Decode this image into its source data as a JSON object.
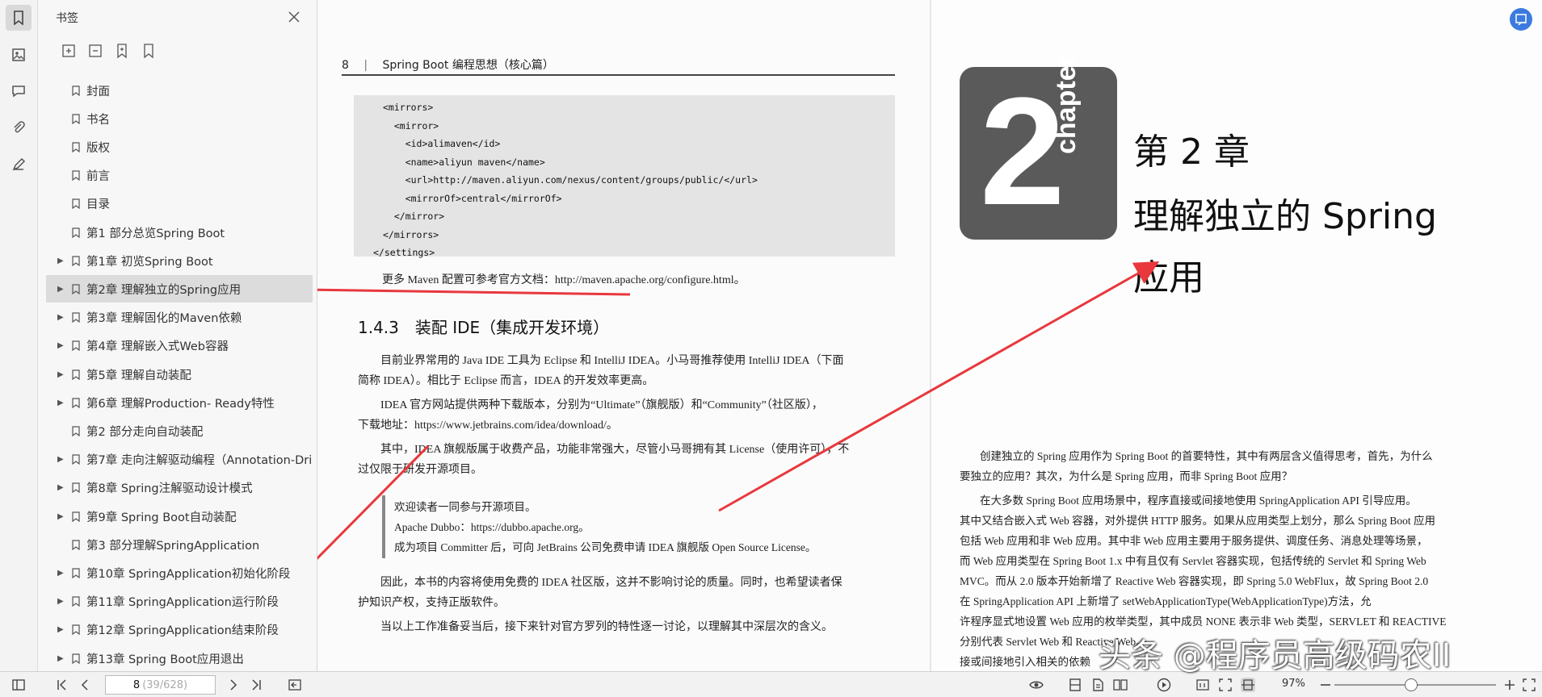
{
  "panel": {
    "title": "书签",
    "items": [
      {
        "label": "封面",
        "expandable": false
      },
      {
        "label": "书名",
        "expandable": false
      },
      {
        "label": "版权",
        "expandable": false
      },
      {
        "label": "前言",
        "expandable": false
      },
      {
        "label": "目录",
        "expandable": false
      },
      {
        "label": "第1 部分总览Spring Boot",
        "expandable": false
      },
      {
        "label": "第1章 初览Spring Boot",
        "expandable": true
      },
      {
        "label": "第2章 理解独立的Spring应用",
        "expandable": true
      },
      {
        "label": "第3章 理解固化的Maven依赖",
        "expandable": true
      },
      {
        "label": "第4章 理解嵌入式Web容器",
        "expandable": true
      },
      {
        "label": "第5章 理解自动装配",
        "expandable": true
      },
      {
        "label": "第6章 理解Production- Ready特性",
        "expandable": true
      },
      {
        "label": "第2 部分走向自动装配",
        "expandable": false
      },
      {
        "label": "第7章 走向注解驱动编程（Annotation-Dri",
        "expandable": true
      },
      {
        "label": "第8章 Spring注解驱动设计模式",
        "expandable": true
      },
      {
        "label": "第9章 Spring Boot自动装配",
        "expandable": true
      },
      {
        "label": "第3 部分理解SpringApplication",
        "expandable": false
      },
      {
        "label": "第10章 SpringApplication初始化阶段",
        "expandable": true
      },
      {
        "label": "第11章 SpringApplication运行阶段",
        "expandable": true
      },
      {
        "label": "第12章 SpringApplication结束阶段",
        "expandable": true
      },
      {
        "label": "第13章 Spring Boot应用退出",
        "expandable": true
      }
    ],
    "selected_index": 7
  },
  "left_page": {
    "header_num": "8",
    "header_title": "Spring Boot 编程思想（核心篇）",
    "code_lines": [
      "<mirrors>",
      "  <mirror>",
      "    <id>alimaven</id>",
      "    <name>aliyun maven</name>",
      "    <url>http://maven.aliyun.com/nexus/content/groups/public/</url>",
      "    <mirrorOf>central</mirrorOf>",
      "  </mirror>",
      "</mirrors>",
      "</settings>"
    ],
    "maven_note": "更多 Maven 配置可参考官方文档：http://maven.apache.org/configure.html。",
    "section": "1.4.3　装配 IDE（集成开发环境）",
    "para1_l1": "目前业界常用的 Java IDE 工具为 Eclipse 和 IntelliJ IDEA。小马哥推荐使用 IntelliJ IDEA（下面",
    "para1_l2": "简称 IDEA）。相比于 Eclipse 而言，IDEA 的开发效率更高。",
    "para2_l1": "IDEA 官方网站提供两种下载版本，分别为“Ultimate”（旗舰版）和“Community”（社区版），",
    "para2_l2": "下载地址：https://www.jetbrains.com/idea/download/。",
    "para3_l1": "其中，IDEA 旗舰版属于收费产品，功能非常强大，尽管小马哥拥有其 License（使用许可），不",
    "para3_l2": "过仅限于研发开源项目。",
    "quote_l1": "欢迎读者一同参与开源项目。",
    "quote_l2": "Apache Dubbo：https://dubbo.apache.org。",
    "quote_l3": "成为项目 Committer 后，可向 JetBrains 公司免费申请 IDEA 旗舰版 Open Source License。",
    "para4_l1": "因此，本书的内容将使用免费的 IDEA 社区版，这并不影响讨论的质量。同时，也希望读者保",
    "para4_l2": "护知识产权，支持正版软件。",
    "para5": "当以上工作准备妥当后，接下来针对官方罗列的特性逐一讨论，以理解其中深层次的含义。"
  },
  "right_page": {
    "chapter_num": "2",
    "chapter_word": "chapter",
    "chapter_label": "第 2 章",
    "chapter_title_l1": "理解独立的 Spring",
    "chapter_title_l2": "应用",
    "body": [
      "创建独立的 Spring 应用作为 Spring Boot 的首要特性，其中有两层含义值得思考，首先，为什么",
      "要独立的应用？其次，为什么是 Spring 应用，而非 Spring Boot 应用？",
      "在大多数 Spring Boot 应用场景中，程序直接或间接地使用 SpringApplication API 引导应用。",
      "其中又结合嵌入式 Web 容器，对外提供 HTTP 服务。如果从应用类型上划分，那么 Spring Boot 应用",
      "包括 Web 应用和非 Web 应用。其中非 Web 应用主要用于服务提供、调度任务、消息处理等场景，",
      "而 Web 应用类型在 Spring Boot 1.x 中有且仅有 Servlet 容器实现，包括传统的 Servlet 和 Spring Web",
      "MVC。而从 2.0 版本开始新增了 Reactive Web 容器实现，即 Spring 5.0 WebFlux，故 Spring Boot 2.0",
      "在 SpringApplication API 上新增了 setWebApplicationType(WebApplicationType)方法，允",
      "许程序显式地设置 Web 应用的枚举类型，其中成员 NONE 表示非 Web 类型，SERVLET 和 REACTIVE",
      "分别代表 Servlet Web 和 Reactive Web。",
      "接或间接地引入相关的依赖"
    ]
  },
  "bottom_bar": {
    "page_current": "8",
    "page_total": "(39/628)",
    "zoom": "97%",
    "zoom_fraction": 0.47
  },
  "watermark": "头条 @程序员高级码农II",
  "colors": {
    "arrow": "#e8383d",
    "selection": "#dcdcdc",
    "chapter_box": "#5a5a5a",
    "accent_button": "#3b7be0"
  }
}
